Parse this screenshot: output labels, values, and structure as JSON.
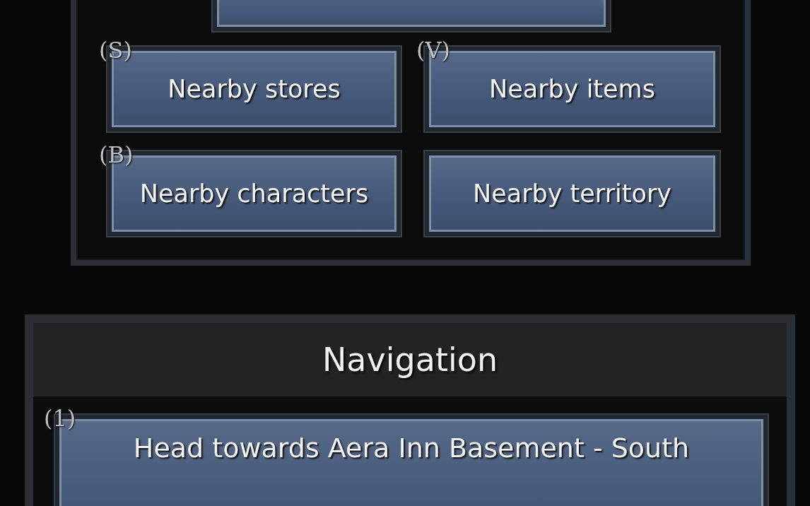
{
  "explore": {
    "buttons": [
      {
        "label": "Nearby stores",
        "hotkey": "(S)"
      },
      {
        "label": "Nearby items",
        "hotkey": "(V)"
      },
      {
        "label": "Nearby characters",
        "hotkey": "(B)"
      },
      {
        "label": "Nearby territory"
      }
    ]
  },
  "navigation": {
    "title": "Navigation",
    "steps": [
      {
        "hotkey": "(1)",
        "label": "Head towards Aera Inn Basement - South"
      }
    ]
  }
}
